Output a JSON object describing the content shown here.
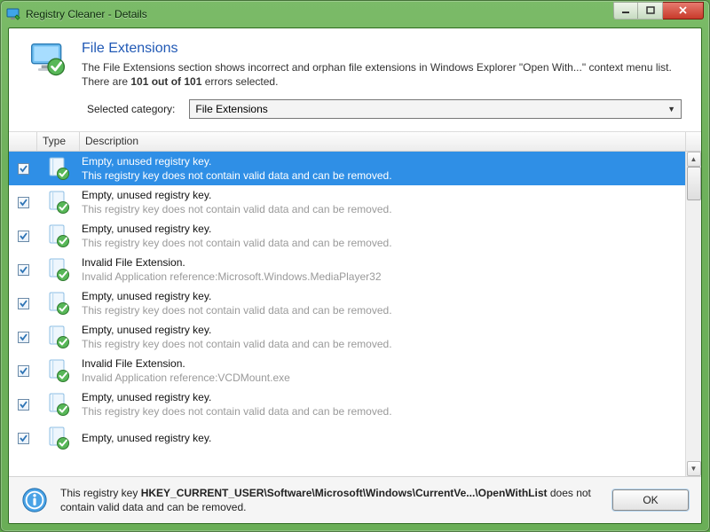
{
  "window": {
    "title": "Registry Cleaner - Details"
  },
  "header": {
    "title": "File Extensions",
    "desc_prefix": "The File Extensions section shows incorrect and orphan file extensions in Windows Explorer \"Open With...\" context menu list. There are ",
    "desc_bold": "101 out of 101",
    "desc_suffix": " errors selected."
  },
  "category": {
    "label": "Selected category:",
    "selected": "File Extensions"
  },
  "columns": {
    "type": "Type",
    "description": "Description"
  },
  "rows": [
    {
      "checked": true,
      "selected": true,
      "title": "Empty, unused registry key.",
      "sub": "This registry key does not contain valid data and can be removed."
    },
    {
      "checked": true,
      "selected": false,
      "title": "Empty, unused registry key.",
      "sub": "This registry key does not contain valid data and can be removed."
    },
    {
      "checked": true,
      "selected": false,
      "title": "Empty, unused registry key.",
      "sub": "This registry key does not contain valid data and can be removed."
    },
    {
      "checked": true,
      "selected": false,
      "title": "Invalid File Extension.",
      "sub": "Invalid Application reference:Microsoft.Windows.MediaPlayer32"
    },
    {
      "checked": true,
      "selected": false,
      "title": "Empty, unused registry key.",
      "sub": "This registry key does not contain valid data and can be removed."
    },
    {
      "checked": true,
      "selected": false,
      "title": "Empty, unused registry key.",
      "sub": "This registry key does not contain valid data and can be removed."
    },
    {
      "checked": true,
      "selected": false,
      "title": "Invalid File Extension.",
      "sub": "Invalid Application reference:VCDMount.exe"
    },
    {
      "checked": true,
      "selected": false,
      "title": "Empty, unused registry key.",
      "sub": "This registry key does not contain valid data and can be removed."
    },
    {
      "checked": true,
      "selected": false,
      "title": "Empty, unused registry key.",
      "sub": ""
    }
  ],
  "footer": {
    "prefix": "This registry key ",
    "bold": "HKEY_CURRENT_USER\\Software\\Microsoft\\Windows\\CurrentVe...\\OpenWithList",
    "suffix": " does not contain valid data and can be removed.",
    "ok": "OK"
  }
}
